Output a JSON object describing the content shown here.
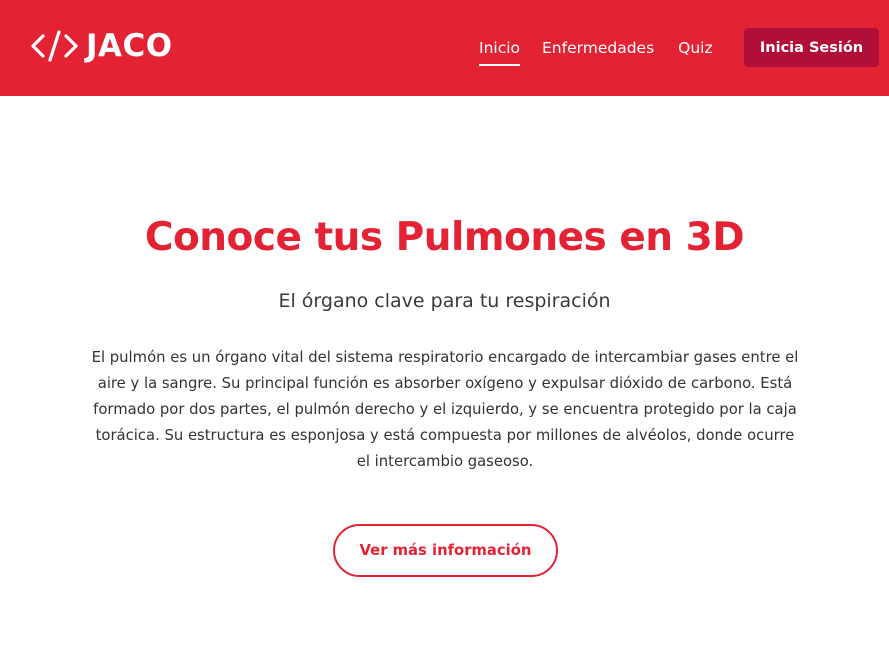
{
  "header": {
    "brand": "JACO",
    "logo_icon": "code-brackets-icon",
    "background_color": "#e32234",
    "nav": [
      {
        "label": "Inicio",
        "active": true
      },
      {
        "label": "Enfermedades",
        "active": false
      },
      {
        "label": "Quiz",
        "active": false
      }
    ],
    "login_label": "Inicia Sesión",
    "login_color": "#b10f3a"
  },
  "hero": {
    "title": "Conoce tus Pulmones en 3D",
    "subtitle": "El órgano clave para tu respiración",
    "description": "El pulmón es un órgano vital del sistema respiratorio encargado de intercambiar gases entre el aire y la sangre. Su principal función es absorber oxígeno y expulsar dióxido de carbono. Está formado por dos partes, el pulmón derecho y el izquierdo, y se encuentra protegido por la caja torácica. Su estructura es esponjosa y está compuesta por millones de alvéolos, donde ocurre el intercambio gaseoso.",
    "cta_label": "Ver más información",
    "accent_color": "#e32234"
  }
}
